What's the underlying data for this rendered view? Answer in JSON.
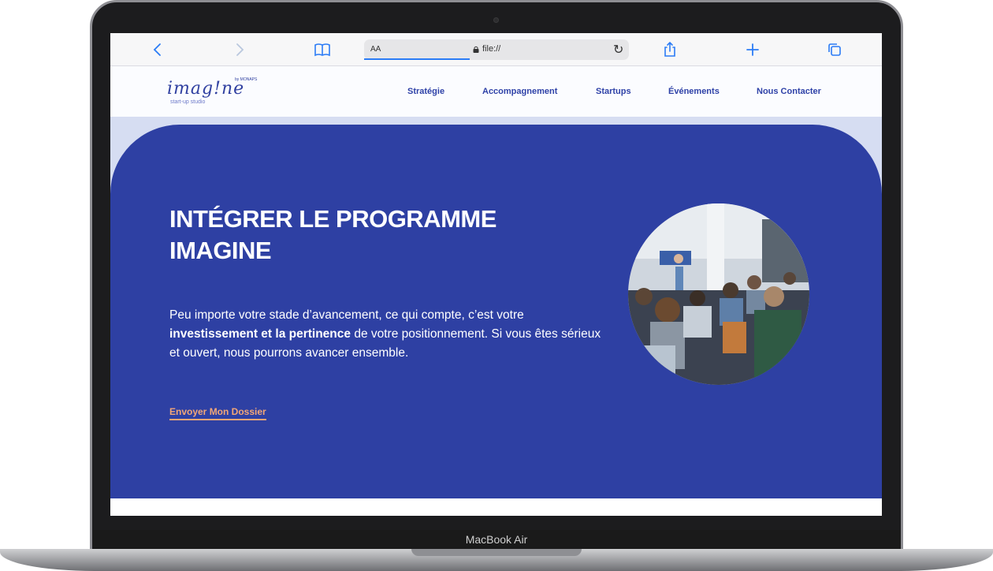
{
  "browser": {
    "address_prefix": "AA",
    "url": "file://",
    "icons": [
      "back-icon",
      "forward-icon",
      "book-icon",
      "lock-icon",
      "reload-icon",
      "share-icon",
      "plus-icon",
      "tabs-icon"
    ],
    "accent_color": "#2b7cf6"
  },
  "site": {
    "logo_text": "imag!ne",
    "logo_by": "by MONAPS",
    "logo_sub": "start-up studio",
    "nav": [
      "Stratégie",
      "Accompagnement",
      "Startups",
      "Événements",
      "Nous Contacter"
    ],
    "brand_color": "#2e40a3"
  },
  "hero": {
    "title_line1": "INTÉGRER LE PROGRAMME",
    "title_line2": "IMAGINE",
    "text_part1": "Peu importe votre stade d’avancement, ce qui compte, c’est votre ",
    "text_bold": "investissement et la pertinence",
    "text_part2": " de votre positionnement. Si vous êtes sérieux et ouvert, nous pourrons avancer ensemble.",
    "cta_label": "Envoyer Mon Dossier",
    "cta_color": "#f2a677"
  },
  "device": {
    "label": "MacBook Air"
  }
}
